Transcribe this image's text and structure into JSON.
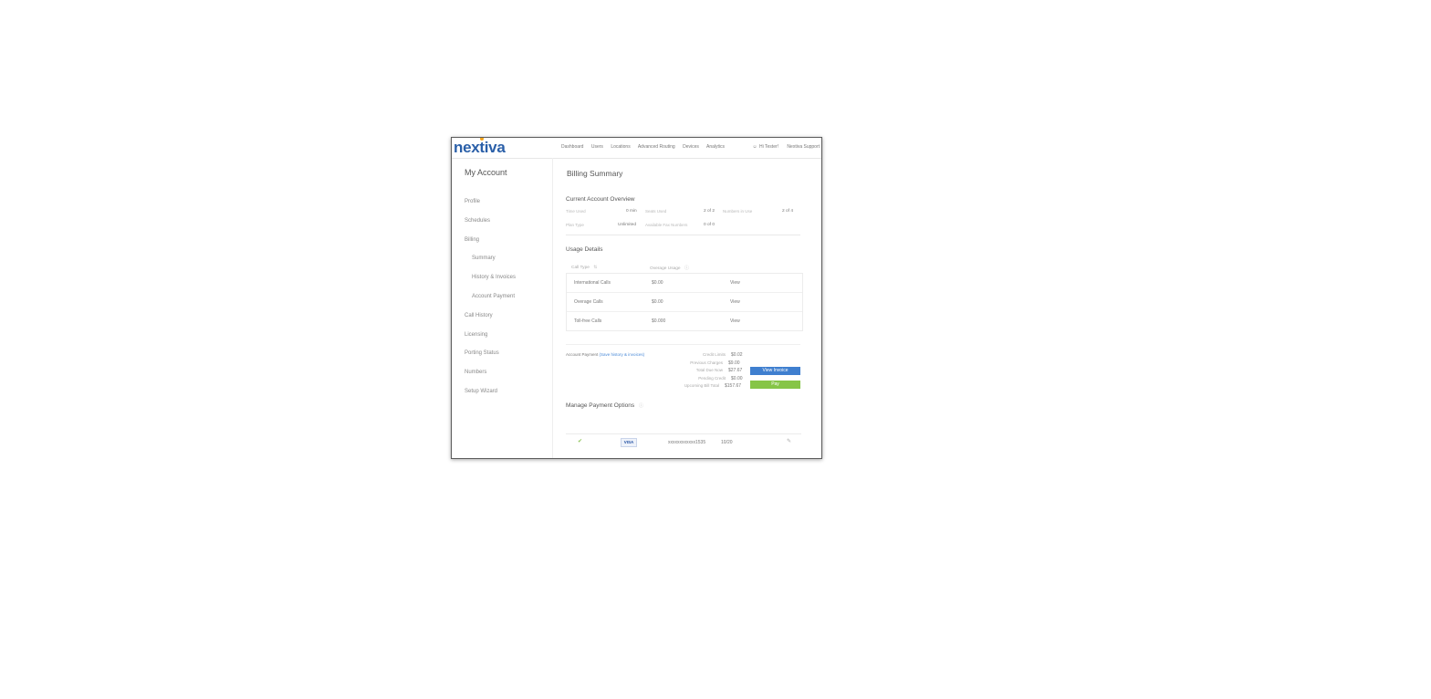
{
  "brand": {
    "name": "nextiva",
    "color": "#2a5fa8",
    "accent": "#f2a31b"
  },
  "nav": {
    "items": [
      "Dashboard",
      "Users",
      "Locations",
      "Advanced Routing",
      "Devices",
      "Analytics"
    ],
    "right": [
      "Hi Tester!",
      "Nextiva Support"
    ]
  },
  "sidebar": {
    "title": "My Account",
    "items": [
      "Profile",
      "Schedules",
      "Billing",
      "Summary",
      "History & Invoices",
      "Account Payment",
      "Call History",
      "Licensing",
      "Porting Status",
      "Numbers",
      "Setup Wizard"
    ]
  },
  "main": {
    "title": "Billing Summary",
    "overview": {
      "title": "Current Account Overview",
      "rows": [
        [
          {
            "label": "Time Used",
            "value": "0 min"
          },
          {
            "label": "Seats Used",
            "value": "2 of 2"
          },
          {
            "label": "Numbers in Use",
            "value": "2 of 4"
          }
        ],
        [
          {
            "label": "Plan Type",
            "value": "Unlimited"
          },
          {
            "label": "Available Fax Numbers",
            "value": "0 of 0"
          }
        ]
      ]
    },
    "usage": {
      "title": "Usage Details",
      "col_type": "Call Type",
      "col_usage": "Overage Usage",
      "rows": [
        {
          "type": "International Calls",
          "value": "$0.00",
          "action": "View"
        },
        {
          "type": "Overage Calls",
          "value": "$0.00",
          "action": "View"
        },
        {
          "type": "Toll-free Calls",
          "value": "$0.000",
          "action": "View"
        }
      ]
    },
    "payment": {
      "label": "Account Payment",
      "link": "(Save history & invoices)",
      "lines": [
        {
          "label": "Credit Limits",
          "value": "$0.02"
        },
        {
          "label": "Previous Charges",
          "value": "$9.00"
        },
        {
          "label": "Total Due Now",
          "value": "$27.67"
        },
        {
          "label": "Pending Credit",
          "value": "$0.00"
        },
        {
          "label": "Upcoming Bill Total",
          "value": "$157.67"
        }
      ],
      "view_invoice": "View Invoice",
      "pay": "Pay"
    },
    "payment_options": {
      "title": "Manage Payment Options",
      "card": {
        "brand": "VISA",
        "number": "xxxxxxxxxxxx1535",
        "expiry": "10/20"
      }
    }
  },
  "colors": {
    "blue_button": "#3f7fcf",
    "green_button": "#86c547"
  }
}
